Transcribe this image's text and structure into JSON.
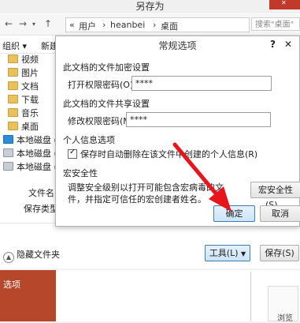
{
  "saveas": {
    "title": "另存为",
    "breadcrumb": [
      "«",
      "用户",
      "›",
      "heanbei",
      "›",
      "桌面"
    ],
    "search_placeholder": "搜索\"桌面\"",
    "organize": "组织 ▾",
    "new_folder": "新建",
    "sidebar": [
      {
        "label": "视频",
        "icon": "folder"
      },
      {
        "label": "图片",
        "icon": "folder"
      },
      {
        "label": "文档",
        "icon": "folder"
      },
      {
        "label": "下载",
        "icon": "folder"
      },
      {
        "label": "音乐",
        "icon": "folder"
      },
      {
        "label": "桌面",
        "icon": "folder"
      },
      {
        "label": "本地磁盘 (",
        "icon": "windows-drive"
      },
      {
        "label": "本地磁盘 (",
        "icon": "drive"
      },
      {
        "label": "本地磁盘 (",
        "icon": "drive"
      }
    ],
    "filename_label": "文件名(N",
    "savetype_label": "保存类型(T",
    "hide_folders": "隐藏文件夹",
    "tools_button": "工具(L)",
    "save_button": "保存(S)"
  },
  "dialog": {
    "title": "常规选项",
    "help": "?",
    "close": "✕",
    "open_section": "此文档的文件加密设置",
    "open_label": "打开权限密码(O):",
    "open_value": "****",
    "modify_section": "此文档的文件共享设置",
    "modify_label": "修改权限密码(M):",
    "modify_value": "****",
    "privacy_section": "个人信息选项",
    "privacy_checkbox": "保存时自动删除在该文件中创建的个人信息(R)",
    "macro_section": "宏安全性",
    "macro_text": "调整安全级别以打开可能包含宏病毒的文件，并指定可信任的宏创建者姓名。",
    "macro_button": "宏安全性(S)...",
    "ok": "确定",
    "cancel": "取消"
  },
  "ppt": {
    "options": "选项",
    "browse": "浏览"
  },
  "colors": {
    "ppt_accent": "#b7472a",
    "annotation_arrow": "#e8151b"
  }
}
